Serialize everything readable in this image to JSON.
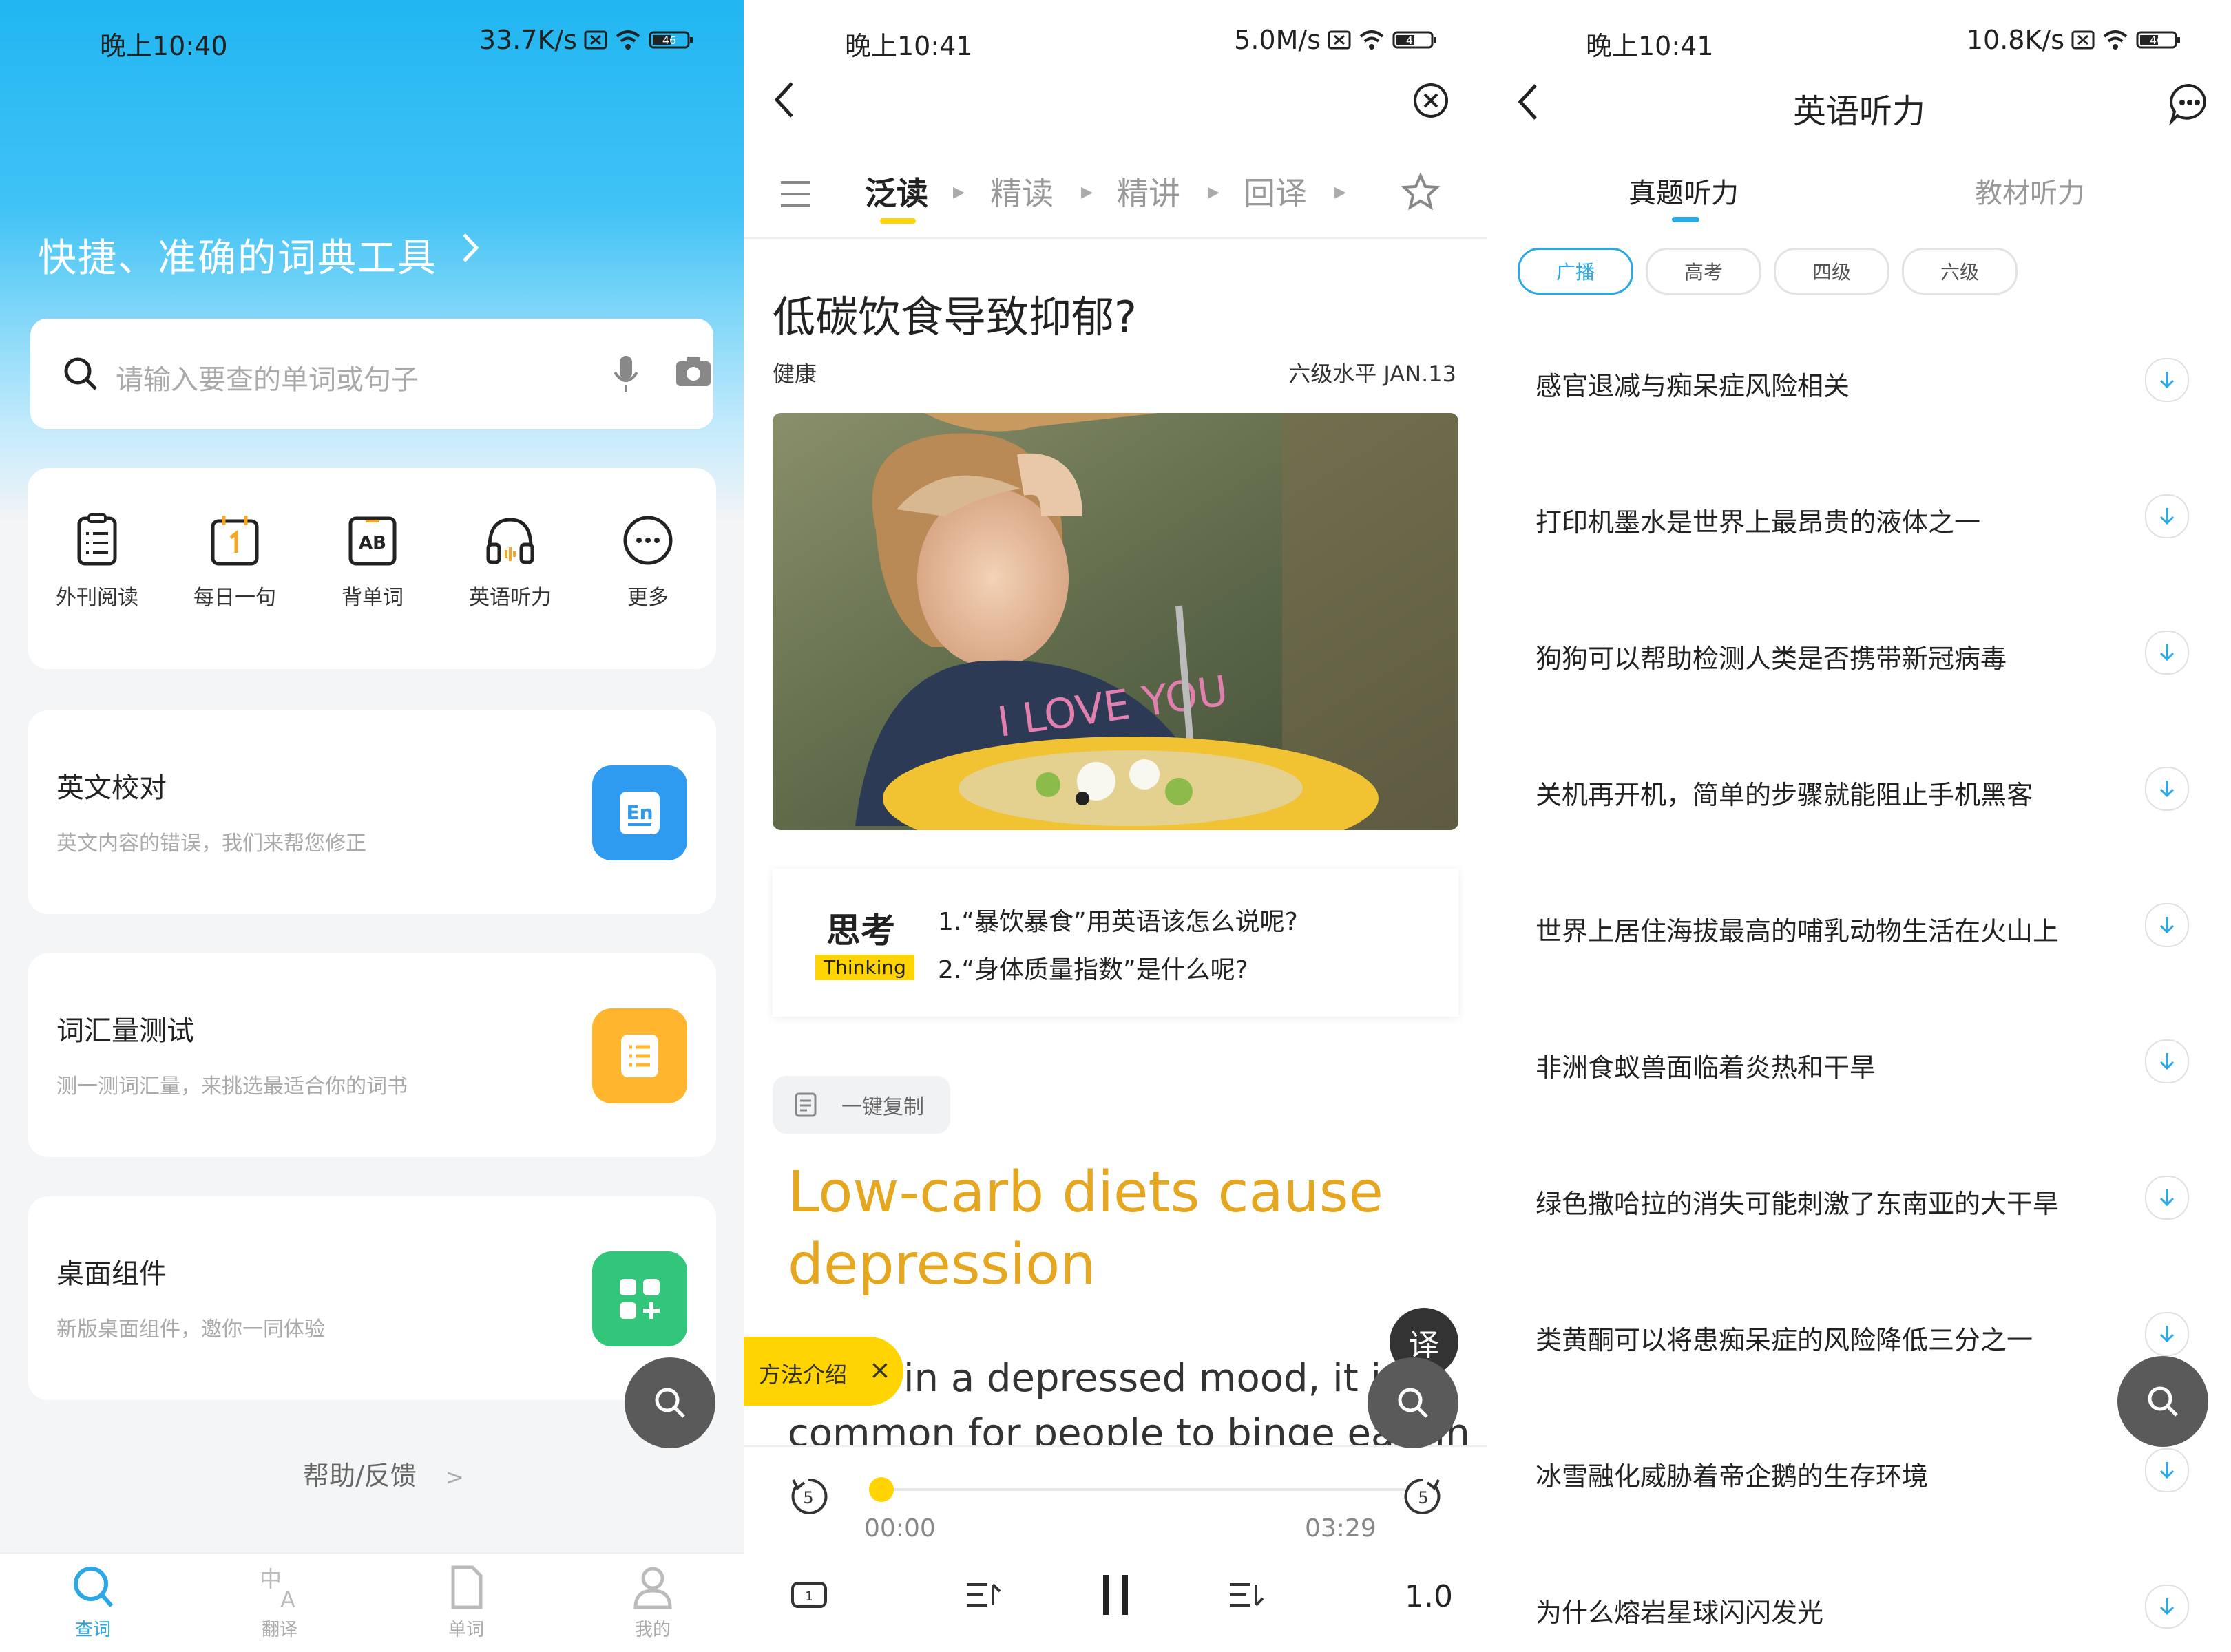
{
  "colors": {
    "accent_blue": "#2aa8e8",
    "accent_yellow": "#ffd400",
    "title_orange": "#e5a620",
    "proofread_blue": "#2e9bf0",
    "vocab_orange": "#ffb52e",
    "widget_green": "#31c67a"
  },
  "dictionary_screen": {
    "status": {
      "time": "晚上10:40",
      "speed": "33.7K/s",
      "battery": "46"
    },
    "headline": "快捷、准确的词典工具",
    "search": {
      "placeholder": "请输入要查的单词或句子"
    },
    "shortcuts": [
      {
        "label": "外刊阅读",
        "icon": "magazine-icon"
      },
      {
        "label": "每日一句",
        "icon": "calendar-icon"
      },
      {
        "label": "背单词",
        "icon": "ab-card-icon"
      },
      {
        "label": "英语听力",
        "icon": "headphones-icon"
      },
      {
        "label": "更多",
        "icon": "more-icon"
      }
    ],
    "features": [
      {
        "title": "英文校对",
        "subtitle": "英文内容的错误，我们来帮您修正",
        "icon": "en-icon"
      },
      {
        "title": "词汇量测试",
        "subtitle": "测一测词汇量，来挑选最适合你的词书",
        "icon": "list-icon"
      },
      {
        "title": "桌面组件",
        "subtitle": "新版桌面组件，邀你一同体验",
        "icon": "widget-icon"
      }
    ],
    "help": "帮助/反馈",
    "help_arrow": ">",
    "nav": [
      {
        "label": "查词",
        "active": true
      },
      {
        "label": "翻译",
        "active": false
      },
      {
        "label": "单词",
        "active": false
      },
      {
        "label": "我的",
        "active": false
      }
    ]
  },
  "article_screen": {
    "status": {
      "time": "晚上10:41",
      "speed": "5.0M/s",
      "battery": "46"
    },
    "tabs": [
      "泛读",
      "精读",
      "精讲",
      "回译"
    ],
    "title": "低碳饮食导致抑郁?",
    "category": "健康",
    "meta": "六级水平 JAN.13",
    "thinking": {
      "label_cn": "思考",
      "label_en": "Thinking",
      "questions": [
        "1.“暴饮暴食”用英语该怎么说呢?",
        "2.“身体质量指数”是什么呢?"
      ]
    },
    "copy_label": "一键复制",
    "english_title": "Low-carb diets cause depression",
    "body_line1": "in a depressed mood, it is",
    "body_line2": "common for people to binge eat. In",
    "method_tag": "方法介绍",
    "method_close": "×",
    "translate_label": "译",
    "player": {
      "current": "00:00",
      "total": "03:29",
      "speed": "1.0",
      "skip_seconds": "5",
      "progress": 0
    }
  },
  "listening_screen": {
    "status": {
      "time": "晚上10:41",
      "speed": "10.8K/s",
      "battery": "46"
    },
    "title": "英语听力",
    "tabs": [
      "真题听力",
      "教材听力"
    ],
    "chips": [
      "广播",
      "高考",
      "四级",
      "六级"
    ],
    "items": [
      "感官退减与痴呆症风险相关",
      "打印机墨水是世界上最昂贵的液体之一",
      "狗狗可以帮助检测人类是否携带新冠病毒",
      "关机再开机，简单的步骤就能阻止手机黑客",
      "世界上居住海拔最高的哺乳动物生活在火山上",
      "非洲食蚁兽面临着炎热和干旱",
      "绿色撒哈拉的消失可能刺激了东南亚的大干旱",
      "类黄酮可以将患痴呆症的风险降低三分之一",
      "冰雪融化威胁着帝企鹅的生存环境",
      "为什么熔岩星球闪闪发光"
    ]
  }
}
